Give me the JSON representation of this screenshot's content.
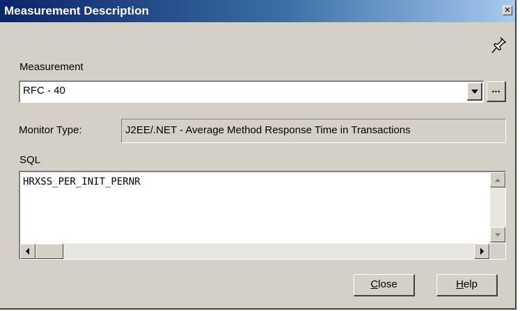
{
  "window": {
    "title": "Measurement Description"
  },
  "measurement": {
    "label": "Measurement",
    "value": "RFC - 40"
  },
  "monitor_type": {
    "label": "Monitor Type:",
    "value": "J2EE/.NET - Average Method Response Time in Transactions"
  },
  "sql": {
    "label": "SQL",
    "value": "HRXSS_PER_INIT_PERNR"
  },
  "buttons": {
    "close": {
      "mnemonic": "C",
      "rest": "lose"
    },
    "help": {
      "mnemonic": "H",
      "rest": "elp"
    },
    "browse": "..."
  },
  "icons": {
    "pin": "pushpin-icon",
    "close": "close-x-icon",
    "dropdown": "chevron-down-icon"
  }
}
